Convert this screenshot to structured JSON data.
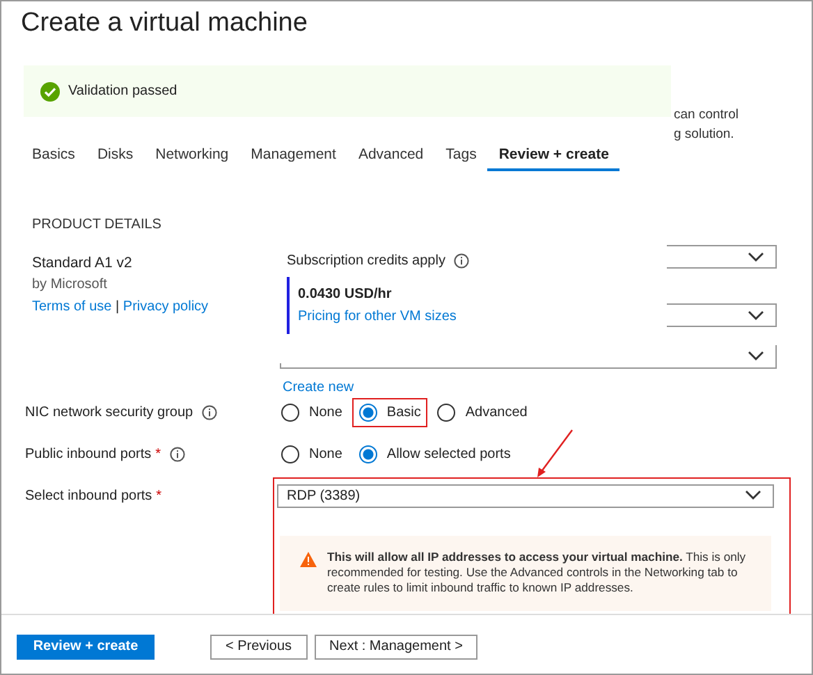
{
  "title": "Create a virtual machine",
  "validation": {
    "message": "Validation passed"
  },
  "background_text": [
    "can control",
    "g solution."
  ],
  "tabs": [
    {
      "label": "Basics",
      "selected": false
    },
    {
      "label": "Disks",
      "selected": false
    },
    {
      "label": "Networking",
      "selected": false
    },
    {
      "label": "Management",
      "selected": false
    },
    {
      "label": "Advanced",
      "selected": false
    },
    {
      "label": "Tags",
      "selected": false
    },
    {
      "label": "Review + create",
      "selected": true
    }
  ],
  "product": {
    "heading": "PRODUCT DETAILS",
    "name": "Standard A1 v2",
    "publisher": "by Microsoft",
    "links": [
      "Terms of use",
      "Privacy policy"
    ],
    "separator": "|"
  },
  "pricing_popup": {
    "note": "Subscription credits apply",
    "price": "0.0430 USD/hr",
    "link": "Pricing for other VM sizes"
  },
  "create_new": "Create new",
  "radio_fields": [
    {
      "label": "NIC network security group",
      "info": true,
      "options": [
        {
          "label": "None",
          "selected": false,
          "highlighted": false
        },
        {
          "label": "Basic",
          "selected": true,
          "highlighted": true
        },
        {
          "label": "Advanced",
          "selected": false,
          "highlighted": false
        }
      ]
    },
    {
      "label": "Public inbound ports",
      "asterisk": "*",
      "info": true,
      "options": [
        {
          "label": "None",
          "selected": false,
          "highlighted": false
        },
        {
          "label": "Allow selected ports",
          "selected": true,
          "highlighted": false
        }
      ]
    }
  ],
  "inbound_ports": {
    "label": "Select inbound ports",
    "asterisk": "*",
    "value": "RDP (3389)",
    "highlighted": true
  },
  "warning": {
    "text": "**This will allow all IP addresses to access your virtual machine.**  This is only recommended for testing.  Use the Advanced controls in the Networking tab to create rules to limit inbound traffic to known IP addresses."
  },
  "buttons": [
    {
      "label": "Review + create",
      "kind": "primary"
    },
    {
      "label": "< Previous",
      "kind": "secondary"
    },
    {
      "label": "Next : Management >",
      "kind": "secondary"
    }
  ]
}
